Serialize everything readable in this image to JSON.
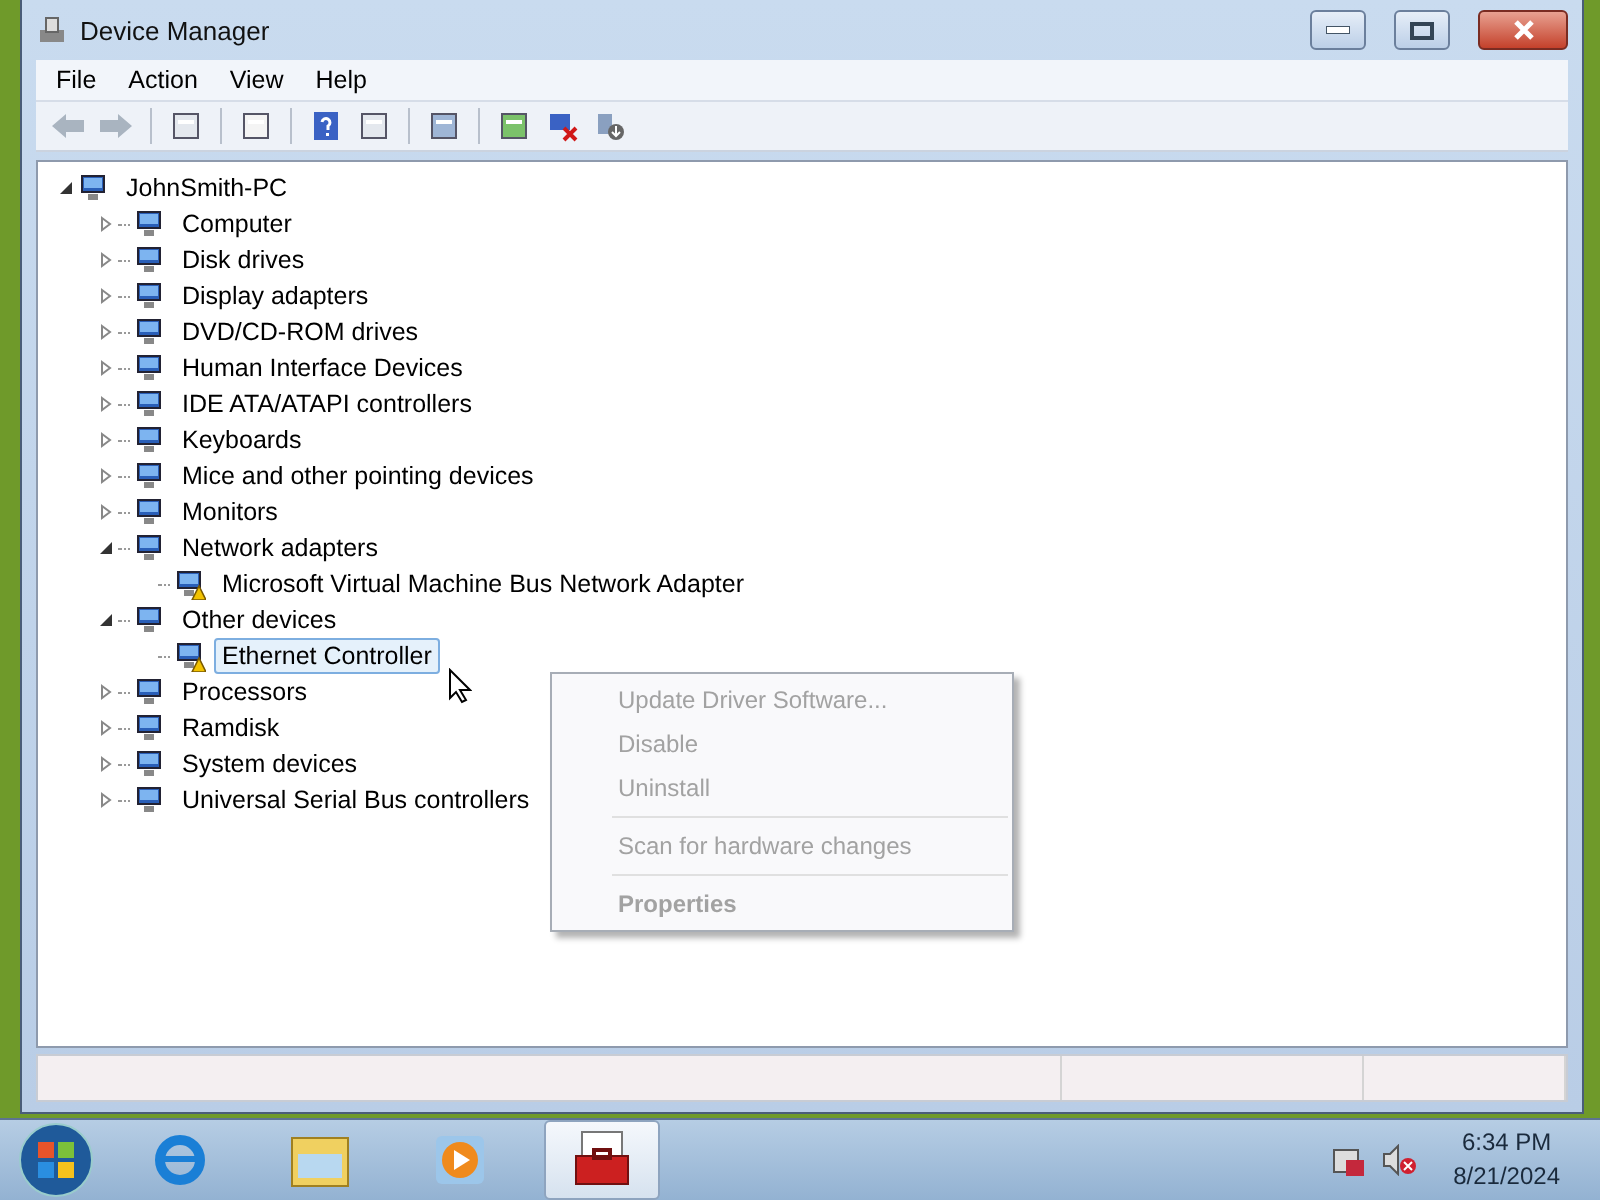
{
  "window": {
    "title": "Device Manager"
  },
  "menu_bar": [
    {
      "label": "File"
    },
    {
      "label": "Action"
    },
    {
      "label": "View"
    },
    {
      "label": "Help"
    }
  ],
  "tree": {
    "label": "JohnSmith-PC",
    "expanded": true,
    "selected": false,
    "children": [
      {
        "label": "Computer",
        "expanded": false,
        "selected": false
      },
      {
        "label": "Disk drives",
        "expanded": false,
        "selected": false
      },
      {
        "label": "Display adapters",
        "expanded": false,
        "selected": false
      },
      {
        "label": "DVD/CD-ROM drives",
        "expanded": false,
        "selected": false
      },
      {
        "label": "Human Interface Devices",
        "expanded": false,
        "selected": false
      },
      {
        "label": "IDE ATA/ATAPI controllers",
        "expanded": false,
        "selected": false
      },
      {
        "label": "Keyboards",
        "expanded": false,
        "selected": false
      },
      {
        "label": "Mice and other pointing devices",
        "expanded": false,
        "selected": false
      },
      {
        "label": "Monitors",
        "expanded": false,
        "selected": false
      },
      {
        "label": "Network adapters",
        "expanded": true,
        "selected": false,
        "children": [
          {
            "label": "Microsoft Virtual Machine Bus Network Adapter",
            "selected": false,
            "warning": true
          }
        ]
      },
      {
        "label": "Other devices",
        "expanded": true,
        "selected": false,
        "children": [
          {
            "label": "Ethernet Controller",
            "selected": true,
            "warning": true
          }
        ]
      },
      {
        "label": "Processors",
        "expanded": false,
        "selected": false
      },
      {
        "label": "Ramdisk",
        "expanded": false,
        "selected": false
      },
      {
        "label": "System devices",
        "expanded": false,
        "selected": false
      },
      {
        "label": "Universal Serial Bus controllers",
        "expanded": false,
        "selected": false
      }
    ]
  },
  "context_menu": [
    {
      "kind": "command",
      "label": "Update Driver Software...",
      "disabled": true,
      "default": false
    },
    {
      "kind": "command",
      "label": "Disable",
      "disabled": true,
      "default": false
    },
    {
      "kind": "command",
      "label": "Uninstall",
      "disabled": true,
      "default": false
    },
    {
      "kind": "separator"
    },
    {
      "kind": "command",
      "label": "Scan for hardware changes",
      "disabled": true,
      "default": false
    },
    {
      "kind": "separator"
    },
    {
      "kind": "command",
      "label": "Properties",
      "disabled": true,
      "default": true
    }
  ],
  "taskbar": {
    "apps": [
      {
        "selected": false
      },
      {
        "selected": false
      },
      {
        "selected": false
      },
      {
        "selected": true
      }
    ],
    "clock": {
      "time": "6:34 PM",
      "date": "8/21/2024"
    }
  }
}
